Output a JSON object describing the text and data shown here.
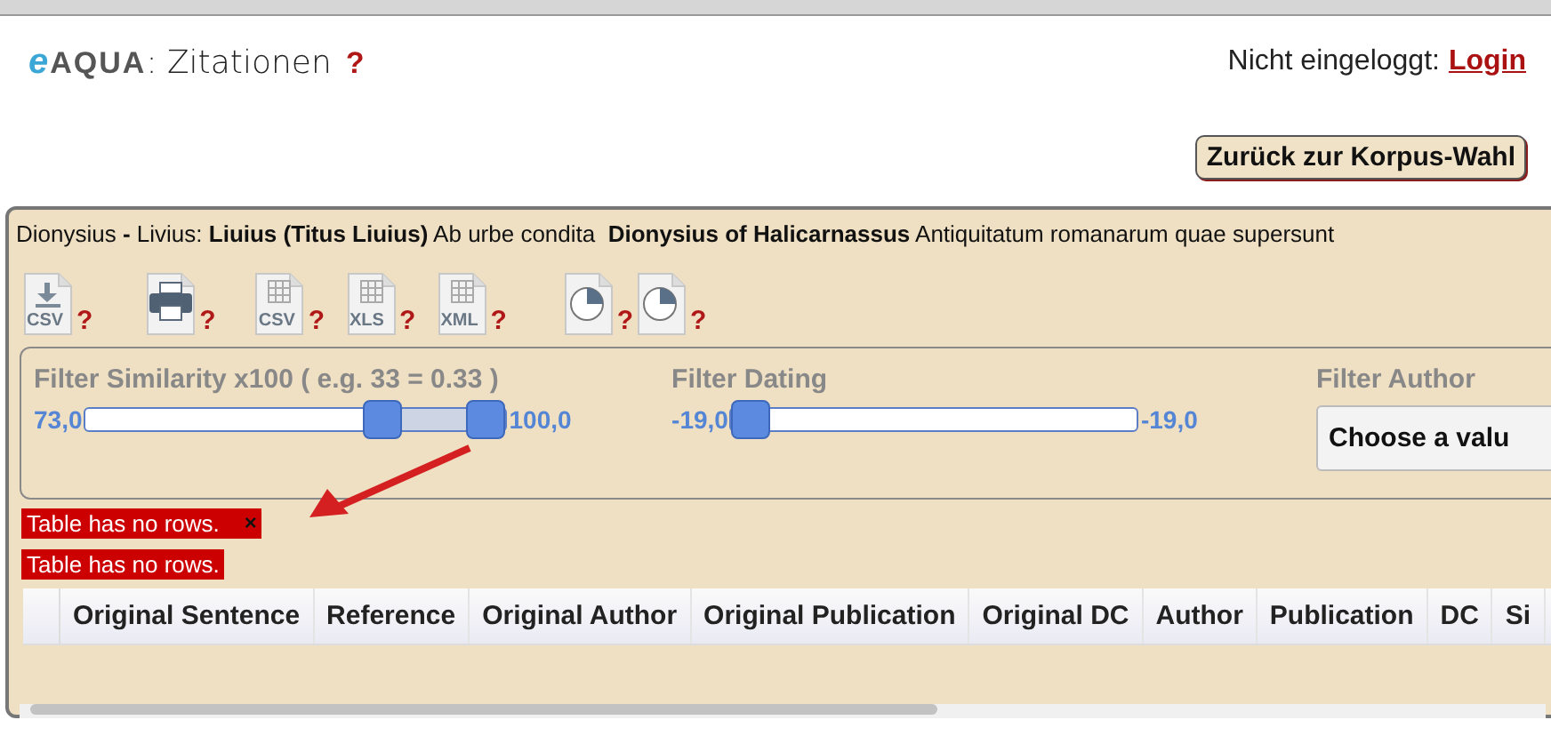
{
  "header": {
    "logo_prefix": "e",
    "logo_text": "AQUA",
    "title": ": Zitationen",
    "help": "?",
    "login_label": "Nicht eingeloggt:",
    "login_link": "Login"
  },
  "back_button": "Zurück zur Korpus-Wahl",
  "corpus_line": "Dionysius **-** Livius: **Liuius (Titus Liuius)** Ab urbe condita  **Dionysius of Halicarnassus** Antiquitatum romanarum quae supersunt",
  "exports": [
    {
      "kind": "download",
      "label": "CSV",
      "help": "?"
    },
    {
      "kind": "print",
      "help": "?"
    },
    {
      "kind": "grid",
      "label": "CSV",
      "help": "?"
    },
    {
      "kind": "grid",
      "label": "XLS",
      "help": "?"
    },
    {
      "kind": "grid",
      "label": "XML",
      "help": "?"
    },
    {
      "kind": "pie",
      "help": "?"
    },
    {
      "kind": "pie",
      "help": "?"
    }
  ],
  "filters": [
    {
      "kind": "range",
      "title": "Filter Similarity x100 ( e.g. 33 = 0.33 )",
      "min_label": "73,0",
      "max_label": "100,0",
      "thumbs": [
        {
          "level": 0.73
        },
        {
          "level": 1.0
        }
      ]
    },
    {
      "kind": "range",
      "title": "Filter Dating",
      "min_label": "-19,0",
      "max_label": "-19,0",
      "thumbs": [
        {
          "level": 0
        }
      ]
    },
    {
      "kind": "select",
      "title": "Filter Author",
      "value": "Choose a valu"
    }
  ],
  "messages": [
    {
      "text": "Table has no rows.",
      "closable": true
    },
    {
      "text": "Table has no rows.",
      "closable": false
    }
  ],
  "close_mark": "×",
  "table": {
    "columns": [
      "Original Sentence",
      "Reference",
      "Original Author",
      "Original Publication",
      "Original DC",
      "Author",
      "Publication",
      "DC",
      "Si"
    ]
  }
}
